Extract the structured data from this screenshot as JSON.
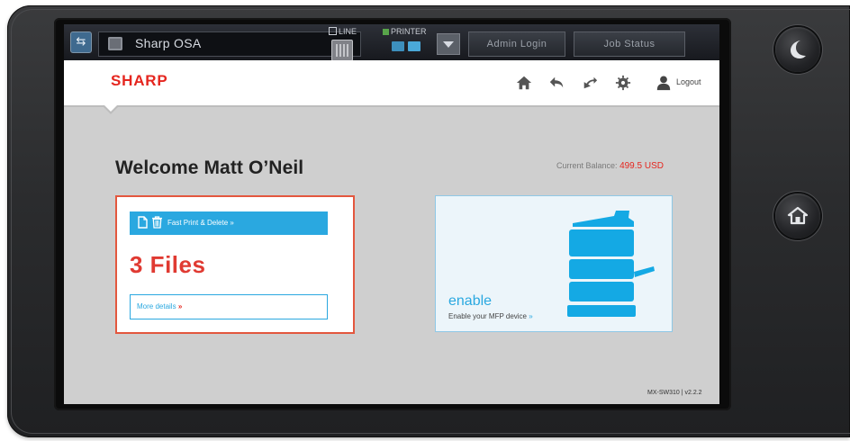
{
  "statusbar": {
    "app_title": "Sharp OSA",
    "line_label": "LINE",
    "printer_label": "PRINTER",
    "admin_login_label": "Admin Login",
    "job_status_label": "Job Status"
  },
  "header": {
    "logo_text": "SHARP",
    "logout_label": "Logout",
    "icons": [
      "home-icon",
      "back-icon",
      "refresh-icon",
      "settings-icon",
      "user-icon"
    ]
  },
  "main": {
    "welcome_text": "Welcome Matt O’Neil",
    "balance_label": "Current Balance:",
    "balance_value": "499.5 USD",
    "fast_print": {
      "label": "Fast Print & Delete",
      "arrow": "»",
      "files_count": "3 Files",
      "more_details_label": "More details",
      "more_details_arrow": "»"
    },
    "enable_card": {
      "title": "enable",
      "subtitle": "Enable your MFP device",
      "arrow": "»"
    },
    "version": "MX-SW310 | v2.2.2"
  },
  "device": {
    "side_buttons": [
      "sleep-button",
      "home-button"
    ]
  },
  "colors": {
    "accent_blue": "#2aa8e0",
    "brand_red": "#e5261f",
    "card_border_orange": "#e3573e",
    "screen_background": "#cfcfcf"
  }
}
